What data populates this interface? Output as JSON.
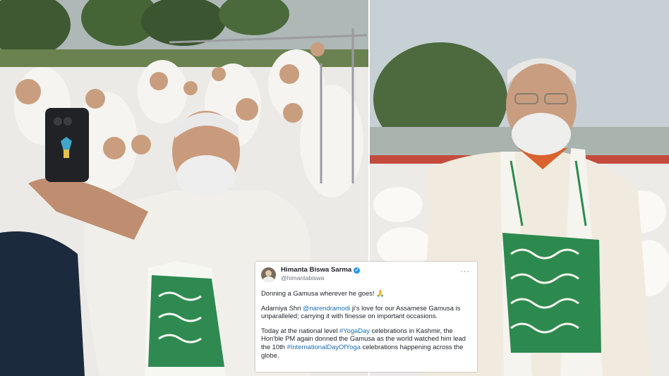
{
  "tweet": {
    "author_name": "Himanta Biswa Sarma",
    "verified_icon": "verified-badge-icon",
    "handle": "@himantabiswa",
    "more_label": "···",
    "line1_text": "Donning a Gamusa wherever he goes! 🙏",
    "para2_prefix": "Adarniya Shri ",
    "para2_mention": "@narendramodi",
    "para2_suffix": " ji's love for our Assamese Gamusa is unparalleled; carrying it with finesse on important occasions.",
    "para3_part1": "Today at the national level ",
    "para3_hashtag1": "#YogaDay",
    "para3_part2": " celebrations in Kashmir, the Hon'ble PM again donned the Gamusa as the world watched him lead the 10th ",
    "para3_hashtag2": "#InternationalDayOfYoga",
    "para3_part3": " celebrations happening across the globe.",
    "link_color": "#1d6fb8"
  },
  "left_photo": {
    "subject": "selfie with crowd in white at lakeside yoga event"
  },
  "right_photo": {
    "subject": "portrait in cream sweater with green-and-white Gamusa stole"
  }
}
